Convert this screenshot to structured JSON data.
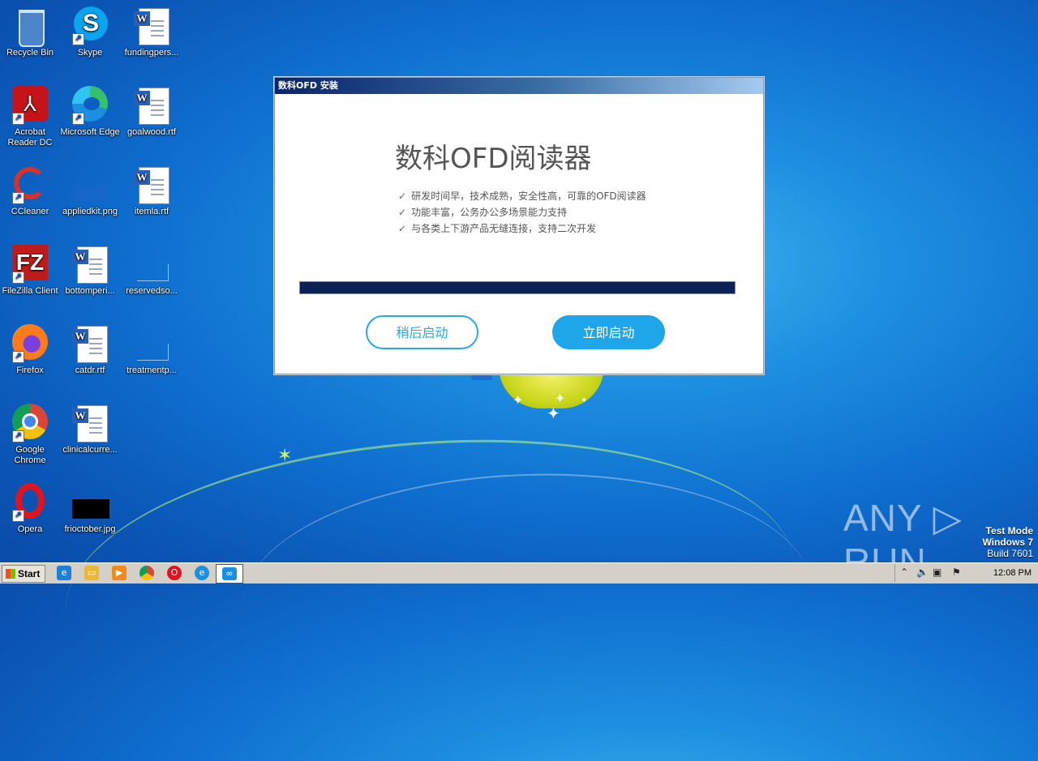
{
  "desktop": {
    "icons": [
      {
        "label": "Recycle Bin"
      },
      {
        "label": "Skype"
      },
      {
        "label": "fundingpers..."
      },
      {
        "label": "Acrobat Reader DC"
      },
      {
        "label": "Microsoft Edge"
      },
      {
        "label": "goalwood.rtf"
      },
      {
        "label": "CCleaner"
      },
      {
        "label": "appliedkit.png"
      },
      {
        "label": "itemla.rtf"
      },
      {
        "label": "FileZilla Client"
      },
      {
        "label": "bottomperi..."
      },
      {
        "label": "reservedso..."
      },
      {
        "label": "Firefox"
      },
      {
        "label": "catdr.rtf"
      },
      {
        "label": "treatmentp..."
      },
      {
        "label": "Google Chrome"
      },
      {
        "label": "clinicalcurre..."
      },
      {
        "label": "Opera"
      },
      {
        "label": "frioctober.jpg"
      }
    ]
  },
  "dialog": {
    "window_title": "数科OFD 安装",
    "heading": "数科OFD阅读器",
    "features": [
      "研发时间早，技术成熟，安全性高，可靠的OFD阅读器",
      "功能丰富，公务办公多场景能力支持",
      "与各类上下游产品无缝连接，支持二次开发"
    ],
    "progress": 1.0,
    "later_button": "稍后启动",
    "now_button": "立即启动"
  },
  "watermark": {
    "brand": "ANY ▷ RUN",
    "line1": "Test Mode",
    "line2": "Windows 7",
    "line3": "Build 7601"
  },
  "taskbar": {
    "start_label": "Start",
    "clock": "12:08 PM"
  },
  "colors": {
    "progress": "#0c2156",
    "accent": "#1ea5ea"
  }
}
